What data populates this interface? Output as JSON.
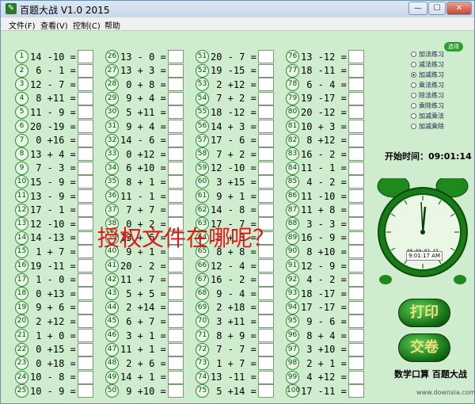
{
  "window": {
    "title": "百题大战 V1.0 2015",
    "min": "—",
    "max": "☐",
    "close": "✕"
  },
  "menu": [
    "文件(F)",
    "查看(V)",
    "控制(C)",
    "帮助"
  ],
  "questions": [
    [
      1,
      "14 -10 ="
    ],
    [
      2,
      " 6 - 1 ="
    ],
    [
      3,
      "12 - 7 ="
    ],
    [
      4,
      " 8 +11 ="
    ],
    [
      5,
      "11 - 9 ="
    ],
    [
      6,
      "20 -19 ="
    ],
    [
      7,
      " 0 +16 ="
    ],
    [
      8,
      "13 + 4 ="
    ],
    [
      9,
      " 7 - 3 ="
    ],
    [
      10,
      "15 - 9 ="
    ],
    [
      11,
      "13 - 9 ="
    ],
    [
      12,
      "17 - 1 ="
    ],
    [
      13,
      "12 -10 ="
    ],
    [
      14,
      "14 -13 ="
    ],
    [
      15,
      " 1 + 7 ="
    ],
    [
      16,
      "19 -11 ="
    ],
    [
      17,
      " 1 - 0 ="
    ],
    [
      18,
      " 0 +13 ="
    ],
    [
      19,
      " 9 + 6 ="
    ],
    [
      20,
      " 2 +12 ="
    ],
    [
      21,
      " 1 + 0 ="
    ],
    [
      22,
      " 0 +15 ="
    ],
    [
      23,
      " 0 +18 ="
    ],
    [
      24,
      "10 - 8 ="
    ],
    [
      25,
      "10 - 9 ="
    ],
    [
      26,
      "13 - 0 ="
    ],
    [
      27,
      "13 + 3 ="
    ],
    [
      28,
      " 0 + 8 ="
    ],
    [
      29,
      " 9 + 4 ="
    ],
    [
      30,
      " 5 +11 ="
    ],
    [
      31,
      " 9 + 4 ="
    ],
    [
      32,
      "14 - 6 ="
    ],
    [
      33,
      " 0 +12 ="
    ],
    [
      34,
      " 6 +10 ="
    ],
    [
      35,
      " 8 + 1 ="
    ],
    [
      36,
      "11 - 1 ="
    ],
    [
      37,
      " 7 + 7 ="
    ],
    [
      38,
      " 0 + 2 ="
    ],
    [
      39,
      "13 + 6 ="
    ],
    [
      40,
      " 9 + 1 ="
    ],
    [
      41,
      "20 - 2 ="
    ],
    [
      42,
      "11 + 7 ="
    ],
    [
      43,
      " 5 + 5 ="
    ],
    [
      44,
      " 2 +14 ="
    ],
    [
      45,
      " 6 + 7 ="
    ],
    [
      46,
      " 3 + 1 ="
    ],
    [
      47,
      "11 + 1 ="
    ],
    [
      48,
      " 2 + 6 ="
    ],
    [
      49,
      "14 + 1 ="
    ],
    [
      50,
      " 9 +10 ="
    ],
    [
      51,
      "20 - 7 ="
    ],
    [
      52,
      "19 -15 ="
    ],
    [
      53,
      " 2 +12 ="
    ],
    [
      54,
      " 7 + 2 ="
    ],
    [
      55,
      "18 -12 ="
    ],
    [
      56,
      "14 + 3 ="
    ],
    [
      57,
      "17 - 6 ="
    ],
    [
      58,
      " 7 + 2 ="
    ],
    [
      59,
      "12 -10 ="
    ],
    [
      60,
      " 3 +15 ="
    ],
    [
      61,
      " 9 + 1 ="
    ],
    [
      62,
      "14 - 8 ="
    ],
    [
      63,
      "17 - 7 ="
    ],
    [
      64,
      " 5 + 3 ="
    ],
    [
      65,
      " 8 + 8 ="
    ],
    [
      66,
      "12 - 4 ="
    ],
    [
      67,
      "16 - 2 ="
    ],
    [
      68,
      " 9 - 4 ="
    ],
    [
      69,
      " 2 +18 ="
    ],
    [
      70,
      " 3 +11 ="
    ],
    [
      71,
      " 8 + 9 ="
    ],
    [
      72,
      " 7 - 7 ="
    ],
    [
      73,
      " 1 + 7 ="
    ],
    [
      74,
      "13 -11 ="
    ],
    [
      75,
      " 5 +14 ="
    ],
    [
      76,
      "13 -12 ="
    ],
    [
      77,
      "18 -11 ="
    ],
    [
      78,
      " 6 - 4 ="
    ],
    [
      79,
      "19 -17 ="
    ],
    [
      80,
      "20 -12 ="
    ],
    [
      81,
      "10 + 3 ="
    ],
    [
      82,
      " 8 +12 ="
    ],
    [
      83,
      "16 - 2 ="
    ],
    [
      84,
      "11 - 1 ="
    ],
    [
      85,
      " 4 - 2 ="
    ],
    [
      86,
      "11 -10 ="
    ],
    [
      87,
      "11 + 8 ="
    ],
    [
      88,
      " 3 - 3 ="
    ],
    [
      89,
      "16 - 9 ="
    ],
    [
      90,
      " 8 +10 ="
    ],
    [
      91,
      "12 - 9 ="
    ],
    [
      92,
      " 4 - 2 ="
    ],
    [
      93,
      "18 -17 ="
    ],
    [
      94,
      "17 -17 ="
    ],
    [
      95,
      " 9 - 6 ="
    ],
    [
      96,
      " 8 + 4 ="
    ],
    [
      97,
      " 3 +10 ="
    ],
    [
      98,
      " 2 + 1 ="
    ],
    [
      99,
      " 4 +12 ="
    ],
    [
      100,
      "17 -11 ="
    ]
  ],
  "modes": [
    {
      "label": "加法练习",
      "checked": false
    },
    {
      "label": "减法练习",
      "checked": false
    },
    {
      "label": "加减练习",
      "checked": true
    },
    {
      "label": "乘法练习",
      "checked": false
    },
    {
      "label": "除法练习",
      "checked": false
    },
    {
      "label": "乘除练习",
      "checked": false
    },
    {
      "label": "加减乘法",
      "checked": false
    },
    {
      "label": "加减乘除",
      "checked": false
    }
  ],
  "leaf_label": "选项",
  "start_time": "开始时间：09:01:14",
  "clock": {
    "elapsed": "00:00:03.43",
    "digital": "9:01:17 AM"
  },
  "print_button": "打印",
  "submit_button": "交卷",
  "footer_label": "数学口算 百题大战",
  "watermark": "授权文件在哪呢？",
  "corner_url": "www.downxia.com",
  "colors": {
    "panel": "#cfeccf",
    "button_green": "#0f6b0f",
    "watermark": "#e21818"
  }
}
